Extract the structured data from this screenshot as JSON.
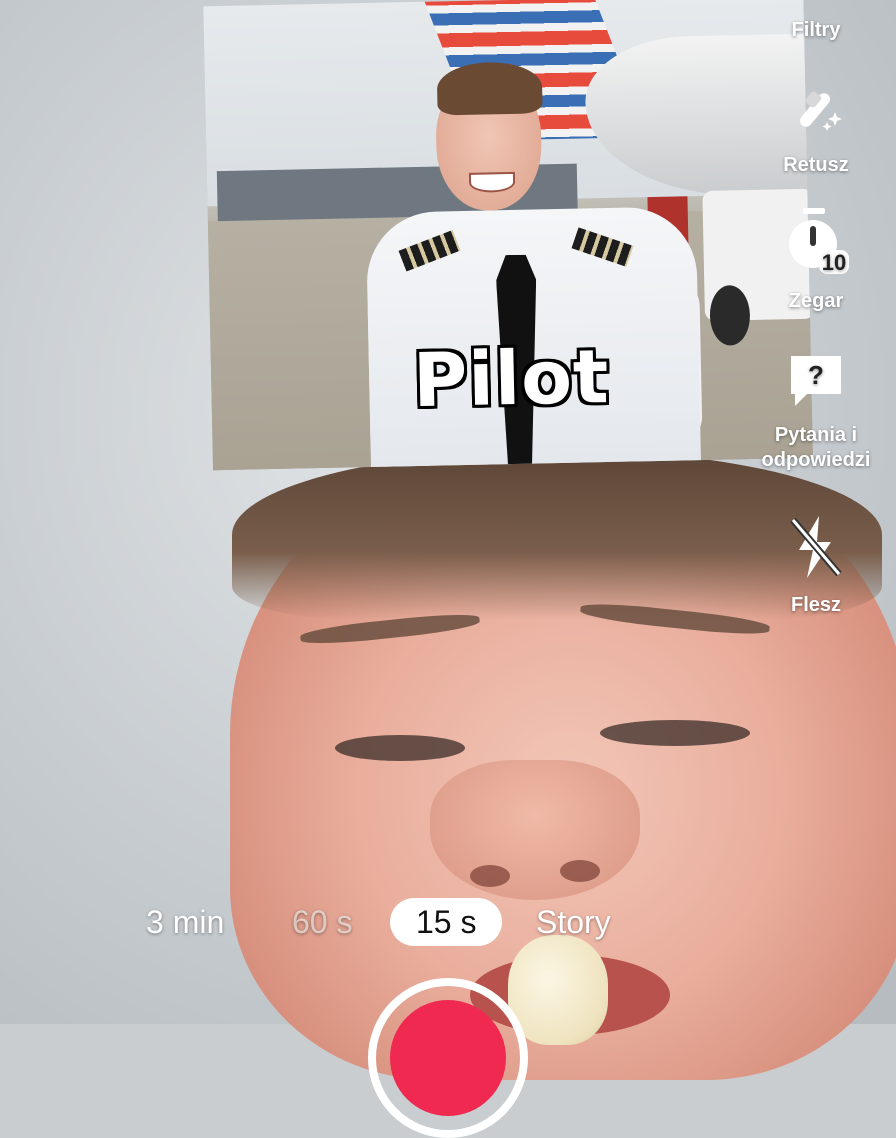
{
  "photo": {
    "caption": "Pilot"
  },
  "tools": [
    {
      "icon": "filters-icon",
      "label": "Filtry"
    },
    {
      "icon": "retouch-wand-icon",
      "label": "Retusz"
    },
    {
      "icon": "timer-icon",
      "label": "Zegar",
      "badge": "10"
    },
    {
      "icon": "question-bubble-icon",
      "label": "Pytania i odpowiedzi"
    },
    {
      "icon": "flash-off-icon",
      "label": "Flesz"
    }
  ],
  "durations": [
    {
      "label": "3 min",
      "state": "normal"
    },
    {
      "label": "60 s",
      "state": "dim"
    },
    {
      "label": "15 s",
      "state": "selected"
    },
    {
      "label": "Story",
      "state": "normal"
    }
  ],
  "colors": {
    "record_button": "#ef2950",
    "selected_pill": "#ffffff"
  }
}
